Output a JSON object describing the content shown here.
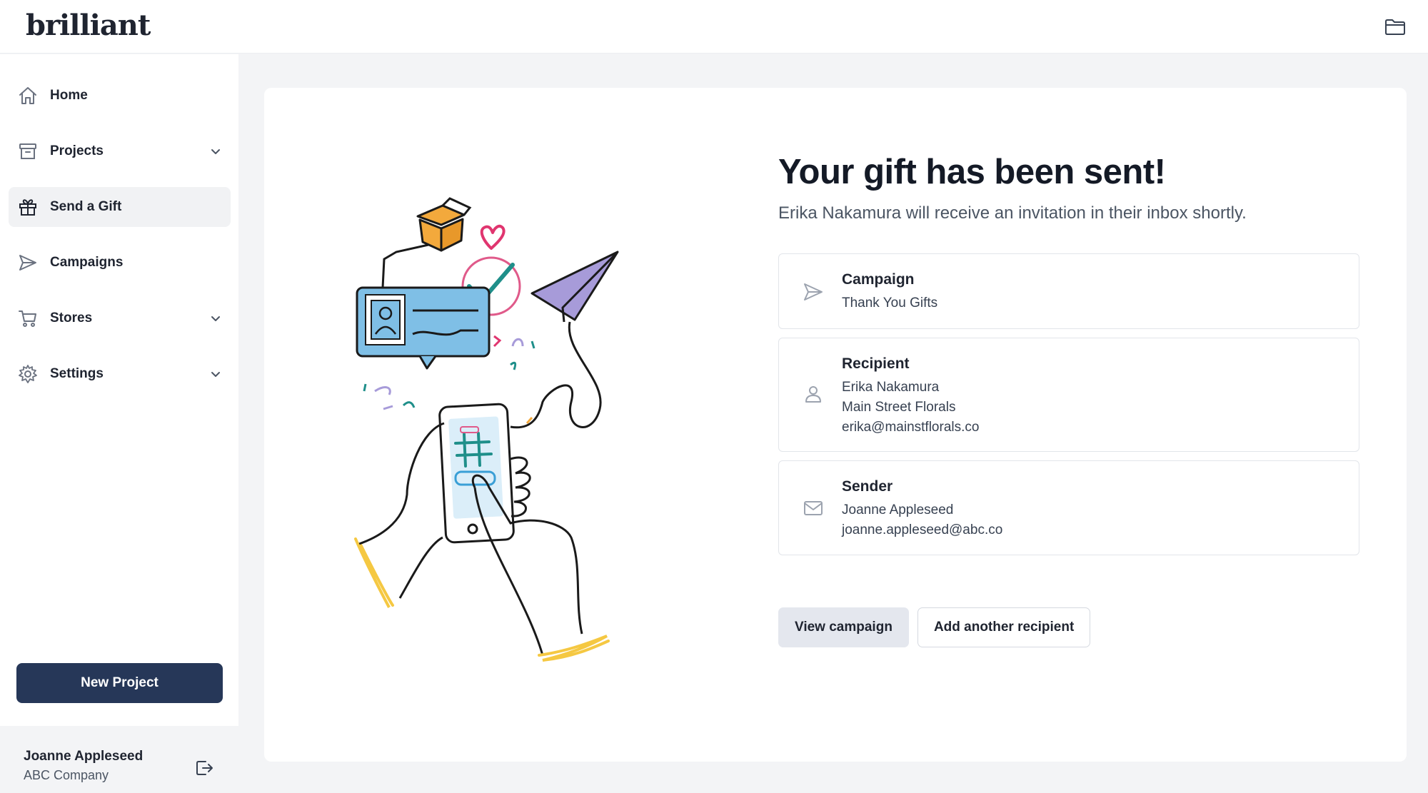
{
  "app": {
    "logo": "brilliant"
  },
  "topbar": {
    "folder_icon": "folder-icon"
  },
  "sidebar": {
    "items": [
      {
        "label": "Home",
        "icon": "home-icon",
        "has_chevron": false,
        "active": false
      },
      {
        "label": "Projects",
        "icon": "archive-box-icon",
        "has_chevron": true,
        "active": false
      },
      {
        "label": "Send a Gift",
        "icon": "gift-icon",
        "has_chevron": false,
        "active": true
      },
      {
        "label": "Campaigns",
        "icon": "paper-plane-icon",
        "has_chevron": false,
        "active": false
      },
      {
        "label": "Stores",
        "icon": "shopping-cart-icon",
        "has_chevron": true,
        "active": false
      },
      {
        "label": "Settings",
        "icon": "gear-icon",
        "has_chevron": true,
        "active": false
      }
    ],
    "new_project_label": "New Project",
    "user": {
      "name": "Joanne Appleseed",
      "company": "ABC Company",
      "logout_icon": "logout-icon"
    }
  },
  "main": {
    "title": "Your gift has been sent!",
    "subtitle": "Erika Nakamura will receive an invitation in their inbox shortly.",
    "campaign": {
      "heading": "Campaign",
      "name": "Thank You Gifts",
      "icon": "paper-plane-icon"
    },
    "recipient": {
      "heading": "Recipient",
      "name": "Erika Nakamura",
      "company": "Main Street Florals",
      "email": "erika@mainstflorals.co",
      "icon": "user-icon"
    },
    "sender": {
      "heading": "Sender",
      "name": "Joanne Appleseed",
      "email": "joanne.appleseed@abc.co",
      "icon": "mail-icon"
    },
    "buttons": {
      "view_campaign": "View campaign",
      "add_recipient": "Add another recipient"
    }
  },
  "colors": {
    "primary_button": "#263758",
    "page_background": "#f3f4f6",
    "active_nav": "#f1f2f4",
    "illustration_blue": "#7fbfe6",
    "illustration_orange": "#f3a93c",
    "illustration_purple": "#a79bd9",
    "illustration_yellow": "#f5c842",
    "illustration_pink": "#e05a8a",
    "illustration_teal": "#1f8f8a"
  }
}
